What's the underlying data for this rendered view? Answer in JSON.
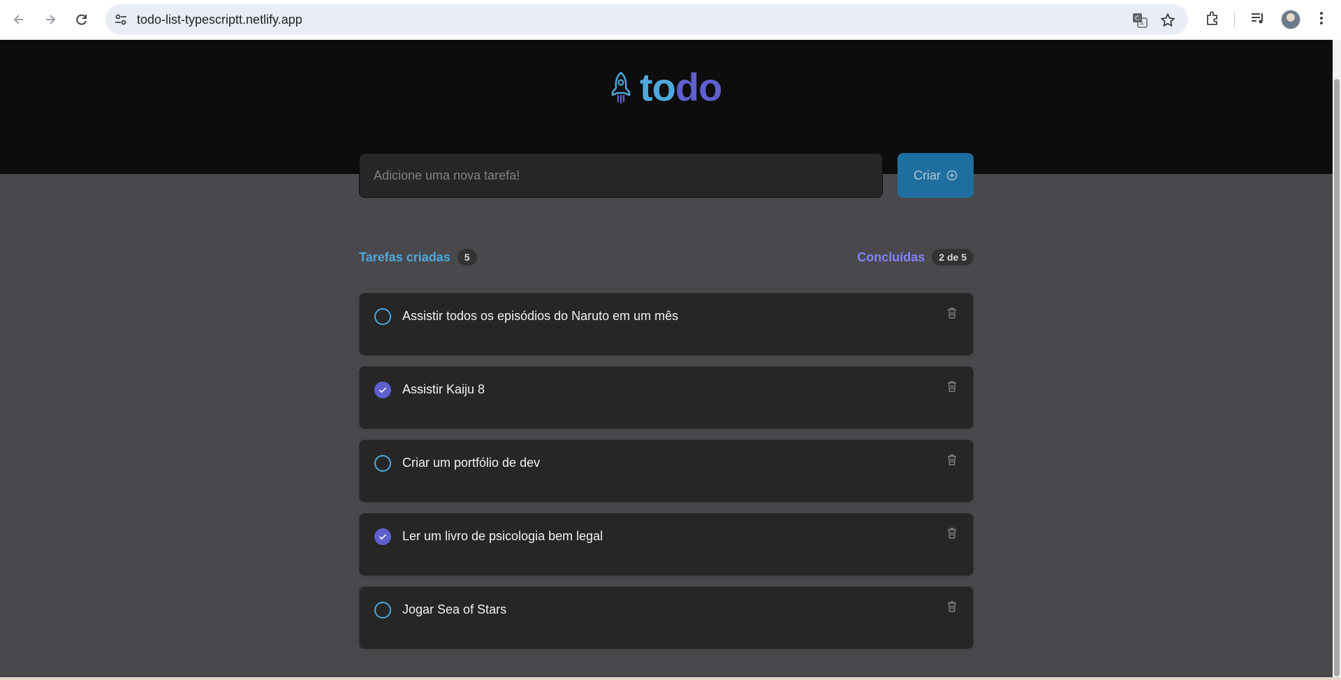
{
  "browser": {
    "url": "todo-list-typescriptt.netlify.app",
    "icons": [
      "back-arrow-icon",
      "forward-arrow-icon",
      "reload-icon",
      "site-info-icon",
      "translate-icon",
      "bookmark-star-icon",
      "extensions-icon",
      "media-control-icon",
      "profile-avatar",
      "more-menu-icon"
    ]
  },
  "app": {
    "logo": {
      "part1": "to",
      "part2": "do",
      "icon": "rocket-icon"
    },
    "input": {
      "placeholder": "Adicione uma nova tarefa!",
      "value": ""
    },
    "create_button": {
      "label": "Criar",
      "icon": "plus-circle-icon"
    },
    "counters": {
      "created_label": "Tarefas criadas",
      "created_count": "5",
      "done_label": "Concluídas",
      "done_count": "2 de 5"
    },
    "tasks": [
      {
        "text": "Assistir todos os episódios do Naruto em um mês",
        "done": false
      },
      {
        "text": "Assistir Kaiju 8",
        "done": true
      },
      {
        "text": "Criar um portfólio de dev",
        "done": false
      },
      {
        "text": "Ler um livro de psicologia bem legal",
        "done": true
      },
      {
        "text": "Jogar Sea of Stars",
        "done": false
      }
    ]
  },
  "colors": {
    "blue": "#4ea8de",
    "purple": "#5e60ce",
    "purple_light": "#8284fa",
    "button": "#1e6f9f",
    "header_bg": "#0d0d0d",
    "body_bg": "#49484c",
    "card_bg": "#262626"
  }
}
